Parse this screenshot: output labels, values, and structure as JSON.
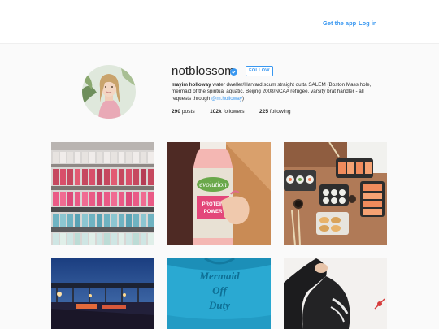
{
  "topbar": {
    "get_app": "Get the app",
    "log_in": "Log in"
  },
  "profile": {
    "username": "notblossom",
    "verified": true,
    "follow_label": "FOLLOW",
    "full_name": "mayim holloway",
    "bio_text": "water dweller/Harvard scum straight outta SALEM (Boston Mass.hole, mermaid of the spiritual aquatic, Beijing 2008/NCAA refugee, varsity brat handler - all requests through",
    "bio_mention": "@m.holloway",
    "bio_end": ")"
  },
  "stats": {
    "posts_count": "290",
    "posts_label": "posts",
    "followers_count": "102k",
    "followers_label": "followers",
    "following_count": "225",
    "following_label": "following"
  },
  "posts": [
    {
      "subject": "nail polish bottles"
    },
    {
      "subject": "protein drink bottle",
      "visible_text": [
        "evolution",
        "PROTEIN",
        "POWER"
      ]
    },
    {
      "subject": "sushi platter"
    },
    {
      "subject": "pier at dusk"
    },
    {
      "subject": "blue t-shirt",
      "visible_text": [
        "Mermaid",
        "Off",
        "Duty"
      ]
    },
    {
      "subject": "person in black hoodie"
    }
  ],
  "colors": {
    "accent": "#3897f0",
    "text": "#262626",
    "background": "#fafafa"
  }
}
